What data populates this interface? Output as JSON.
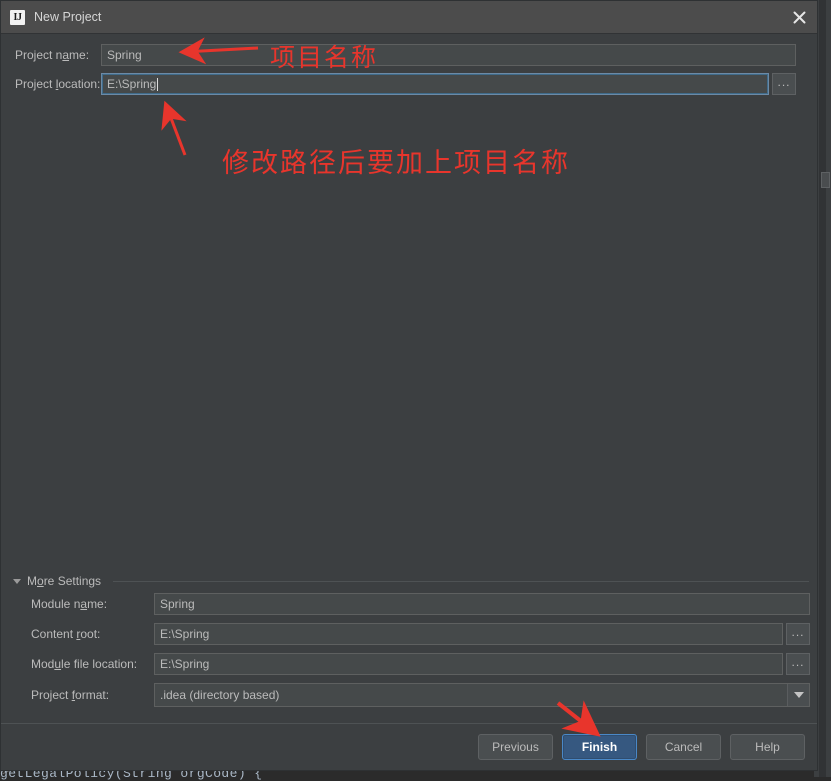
{
  "window": {
    "title": "New Project",
    "logo_icon": "intellij-idea-logo-icon",
    "close_icon": "close-icon"
  },
  "form": {
    "project_name": {
      "label_pre": "Project n",
      "label_mn": "a",
      "label_post": "me:",
      "value": "Spring"
    },
    "project_location": {
      "label_pre": "Project ",
      "label_mn": "l",
      "label_post": "ocation:",
      "value": "E:\\Spring",
      "browse_label": "..."
    }
  },
  "more_settings": {
    "label": "More Settings",
    "triangle_icon": "triangle-down-icon",
    "module_name": {
      "label_pre": "Module n",
      "label_mn": "a",
      "label_post": "me:",
      "value": "Spring"
    },
    "content_root": {
      "label_pre": "Content ",
      "label_mn": "r",
      "label_post": "oot:",
      "value": "E:\\Spring",
      "browse_label": "..."
    },
    "module_file_location": {
      "label_pre": "Mod",
      "label_mn": "u",
      "label_post": "le file location:",
      "value": "E:\\Spring",
      "browse_label": "..."
    },
    "project_format": {
      "label_pre": "Project ",
      "label_mn": "f",
      "label_post": "ormat:",
      "value": ".idea (directory based)",
      "arrow_icon": "chevron-down-icon"
    }
  },
  "footer": {
    "previous_label": "Previous",
    "finish_label": "Finish",
    "cancel_label": "Cancel",
    "help_label": "Help"
  },
  "annotations": {
    "accent_color": "#e8352c",
    "project_name_note": "项目名称",
    "location_note": "修改路径后要加上项目名称",
    "arrow_to_name": "arrow-left-icon",
    "arrow_to_location": "arrow-up-left-icon",
    "arrow_to_finish": "arrow-down-right-icon"
  },
  "background": {
    "code_line": "getLegalPolicy(String orgCode) {",
    "gutter_marker": ">"
  }
}
